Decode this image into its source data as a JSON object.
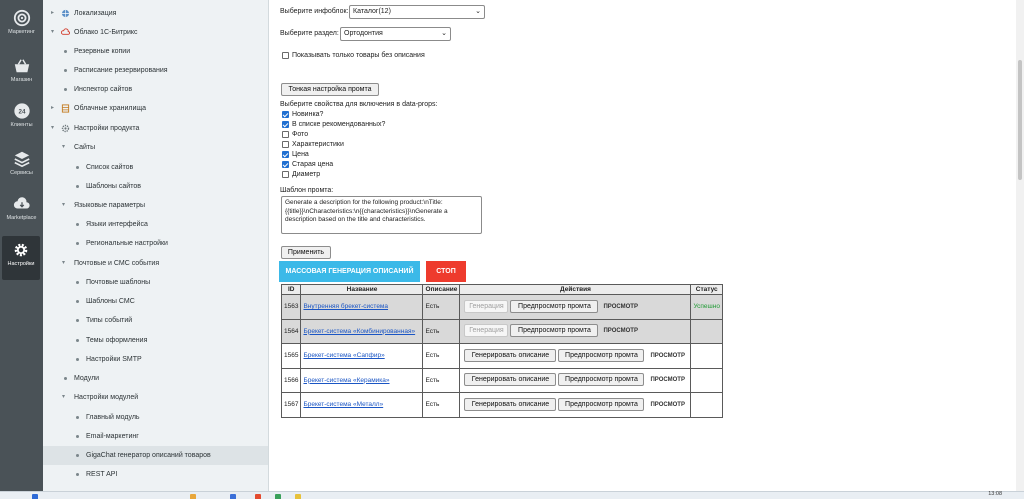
{
  "rail": {
    "items": [
      {
        "label": "Маркетинг"
      },
      {
        "label": "Магазин"
      },
      {
        "label": "Клиенты"
      },
      {
        "label": "Сервисы"
      },
      {
        "label": "Marketplace"
      },
      {
        "label": "Настройки"
      }
    ]
  },
  "tree": {
    "items": [
      {
        "label": "Локализация"
      },
      {
        "label": "Облако 1С-Битрикс"
      },
      {
        "label": "Резервные копии"
      },
      {
        "label": "Расписание резервирования"
      },
      {
        "label": "Инспектор сайтов"
      },
      {
        "label": "Облачные хранилища"
      },
      {
        "label": "Настройки продукта"
      },
      {
        "label": "Сайты"
      },
      {
        "label": "Список сайтов"
      },
      {
        "label": "Шаблоны сайтов"
      },
      {
        "label": "Языковые параметры"
      },
      {
        "label": "Языки интерфейса"
      },
      {
        "label": "Региональные настройки"
      },
      {
        "label": "Почтовые и СМС события"
      },
      {
        "label": "Почтовые шаблоны"
      },
      {
        "label": "Шаблоны СМС"
      },
      {
        "label": "Типы событий"
      },
      {
        "label": "Темы оформления"
      },
      {
        "label": "Настройки SMTP"
      },
      {
        "label": "Модули"
      },
      {
        "label": "Настройки модулей"
      },
      {
        "label": "Главный модуль"
      },
      {
        "label": "Email-маркетинг"
      },
      {
        "label": "GigaChat генератор описаний товаров"
      },
      {
        "label": "REST API"
      }
    ]
  },
  "form": {
    "iblock_label": "Выберите инфоблок:",
    "iblock_value": "Каталог(12)",
    "section_label": "Выберите раздел:",
    "section_value": "Ортодонтия",
    "only_without_desc_label": "Показывать только товары без описания",
    "fine_tune_button": "Тонкая настройка промта",
    "props_label": "Выберите свойства для включения в data-props:",
    "props": [
      {
        "label": "Новинка?",
        "checked": true
      },
      {
        "label": "В списке рекомендованных?",
        "checked": true
      },
      {
        "label": "Фото",
        "checked": false
      },
      {
        "label": "Характеристики",
        "checked": false
      },
      {
        "label": "Цена",
        "checked": true
      },
      {
        "label": "Старая цена",
        "checked": true
      },
      {
        "label": "Диаметр",
        "checked": false
      }
    ],
    "template_label": "Шаблон промта:",
    "template_text": "Generate a description for the following product:\\nTitle: {{title}}\\nCharacteristics:\\n{{characteristics}}\\nGenerate a description based on the title and characteristics.",
    "apply_button": "Применить",
    "mass_button": "МАССОВАЯ ГЕНЕРАЦИЯ ОПИСАНИЙ",
    "stop_button": "СТОП",
    "colors": {
      "mass": "#3bb9e8",
      "stop": "#ee3b2d",
      "link": "#1a55c4",
      "ok": "#1f9a34"
    }
  },
  "table": {
    "headers": [
      "ID",
      "Название",
      "Описание",
      "Действия",
      "Статус"
    ],
    "rows": [
      {
        "id": "1563",
        "name": "Внутренняя брекет-система",
        "desc": "Есть",
        "gen": "Генерация",
        "preview": "Предпросмотр промта",
        "view": "ПРОСМОТР",
        "status": "Успешно"
      },
      {
        "id": "1564",
        "name": "Брекет-система «Комбинированная»",
        "desc": "Есть",
        "gen": "Генерация",
        "preview": "Предпросмотр промта",
        "view": "ПРОСМОТР",
        "status": ""
      },
      {
        "id": "1565",
        "name": "Брекет-система «Сапфир»",
        "desc": "Есть",
        "gen": "Генерировать описание",
        "preview": "Предпросмотр промта",
        "view": "ПРОСМОТР",
        "status": ""
      },
      {
        "id": "1566",
        "name": "Брекет-система «Керамика»",
        "desc": "Есть",
        "gen": "Генерировать описание",
        "preview": "Предпросмотр промта",
        "view": "ПРОСМОТР",
        "status": ""
      },
      {
        "id": "1567",
        "name": "Брекет-система «Металл»",
        "desc": "Есть",
        "gen": "Генерировать описание",
        "preview": "Предпросмотр промта",
        "view": "ПРОСМОТР",
        "status": ""
      }
    ]
  },
  "taskbar": {
    "time": "13:08"
  }
}
